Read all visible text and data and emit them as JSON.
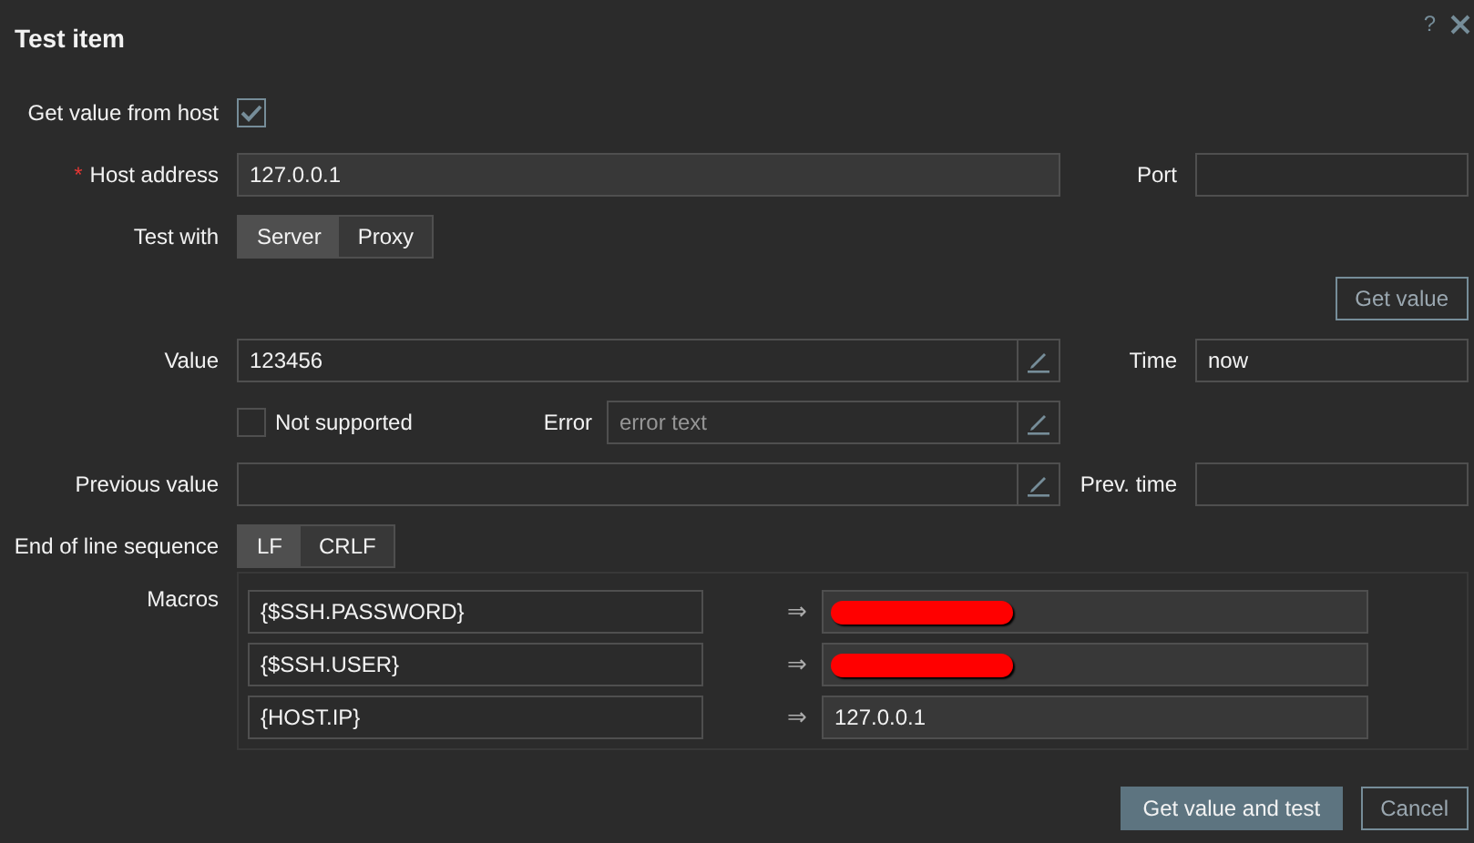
{
  "dialog": {
    "title": "Test item",
    "help": "?"
  },
  "get_value_from_host": {
    "label": "Get value from host",
    "checked": true
  },
  "host_address": {
    "label": "Host address",
    "required_mark": "*",
    "value": "127.0.0.1"
  },
  "port": {
    "label": "Port"
  },
  "test_with": {
    "label": "Test with",
    "options": [
      {
        "label": "Server",
        "selected": true
      },
      {
        "label": "Proxy",
        "selected": false
      }
    ]
  },
  "get_value_button": "Get value",
  "value": {
    "label": "Value",
    "value": "123456"
  },
  "time": {
    "label": "Time",
    "value": "now"
  },
  "not_supported": {
    "label": "Not supported",
    "checked": false
  },
  "error": {
    "label": "Error",
    "placeholder": "error text"
  },
  "previous_value": {
    "label": "Previous value"
  },
  "prev_time": {
    "label": "Prev. time"
  },
  "eol": {
    "label": "End of line sequence",
    "options": [
      {
        "label": "LF",
        "selected": true
      },
      {
        "label": "CRLF",
        "selected": false
      }
    ]
  },
  "macros": {
    "label": "Macros",
    "rows": [
      {
        "name": "{$SSH.PASSWORD}",
        "arrow": "⇒",
        "redacted": true
      },
      {
        "name": "{$SSH.USER}",
        "arrow": "⇒",
        "redacted": true
      },
      {
        "name": "{HOST.IP}",
        "arrow": "⇒",
        "value": "127.0.0.1"
      }
    ]
  },
  "buttons": [
    {
      "label": "Get value and test",
      "kind": "primary"
    },
    {
      "label": "Cancel",
      "kind": "secondary"
    }
  ]
}
